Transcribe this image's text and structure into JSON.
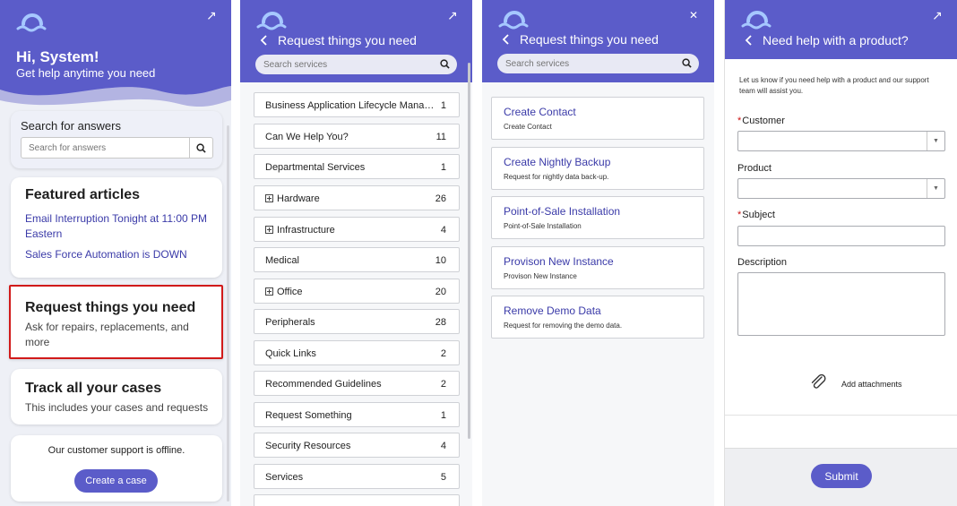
{
  "colors": {
    "brand": "#5b5cc9",
    "link": "#3a3aa8",
    "highlight": "#d11a1a"
  },
  "home": {
    "greeting": "Hi, System!",
    "greeting_sub": "Get help anytime you need",
    "search": {
      "title": "Search for answers",
      "placeholder": "Search for answers"
    },
    "featured": {
      "title": "Featured articles",
      "articles": [
        "Email Interruption Tonight at 11:00 PM Eastern",
        "Sales Force Automation is DOWN"
      ]
    },
    "request": {
      "title": "Request things you need",
      "subtitle": "Ask for repairs, replacements, and more"
    },
    "track": {
      "title": "Track all your cases",
      "subtitle": "This includes your cases and requests"
    },
    "support": {
      "status": "Our customer support is offline.",
      "button": "Create a case"
    }
  },
  "catalog": {
    "title": "Request things you need",
    "search_placeholder": "Search services",
    "categories": [
      {
        "label": "Business Application Lifecycle Management",
        "count": "1",
        "expandable": false
      },
      {
        "label": "Can We Help You?",
        "count": "11",
        "expandable": false
      },
      {
        "label": "Departmental Services",
        "count": "1",
        "expandable": false
      },
      {
        "label": "Hardware",
        "count": "26",
        "expandable": true
      },
      {
        "label": "Infrastructure",
        "count": "4",
        "expandable": true
      },
      {
        "label": "Medical",
        "count": "10",
        "expandable": false
      },
      {
        "label": "Office",
        "count": "20",
        "expandable": true
      },
      {
        "label": "Peripherals",
        "count": "28",
        "expandable": false
      },
      {
        "label": "Quick Links",
        "count": "2",
        "expandable": false
      },
      {
        "label": "Recommended Guidelines",
        "count": "2",
        "expandable": false
      },
      {
        "label": "Request Something",
        "count": "1",
        "expandable": false
      },
      {
        "label": "Security Resources",
        "count": "4",
        "expandable": false
      },
      {
        "label": "Services",
        "count": "5",
        "expandable": false
      }
    ]
  },
  "services": {
    "title": "Request things you need",
    "search_placeholder": "Search services",
    "items": [
      {
        "title": "Create Contact",
        "desc": "Create Contact"
      },
      {
        "title": "Create Nightly Backup",
        "desc": "Request for nightly data back-up."
      },
      {
        "title": "Point-of-Sale Installation",
        "desc": "Point-of-Sale Installation"
      },
      {
        "title": "Provison New Instance",
        "desc": "Provison New Instance"
      },
      {
        "title": "Remove Demo Data",
        "desc": "Request for removing the demo data."
      }
    ]
  },
  "form": {
    "title": "Need help with a product?",
    "intro": "Let us know if you need help with a product and our support team will assist you.",
    "customer_label": "Customer",
    "product_label": "Product",
    "subject_label": "Subject",
    "description_label": "Description",
    "attach_label": "Add attachments",
    "submit_label": "Submit",
    "required_marker": "*",
    "dropdown_glyph": "▼"
  },
  "icons": {
    "expand": "↗",
    "close": "✕"
  }
}
